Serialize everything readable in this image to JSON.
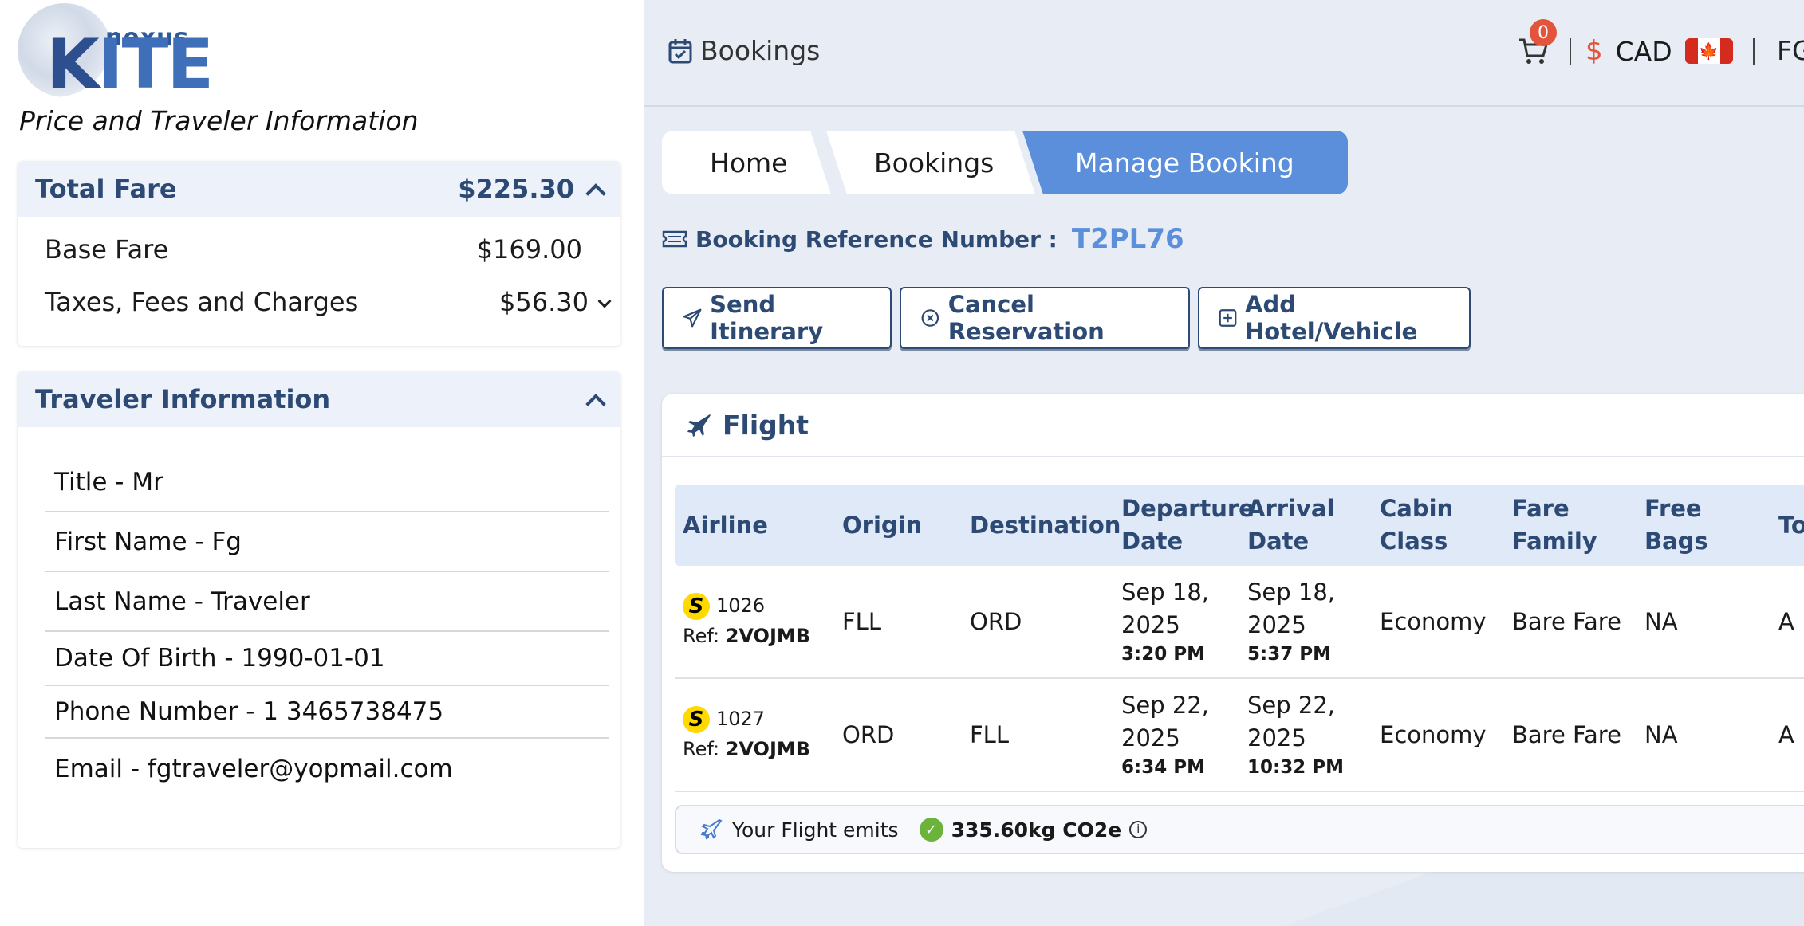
{
  "logo": {
    "small": "nexus",
    "big_k": "K",
    "big_rest": "ITE"
  },
  "left": {
    "heading": "Price and Traveler Information",
    "fare": {
      "title": "Total Fare",
      "total": "$225.30",
      "base_label": "Base Fare",
      "base_value": "$169.00",
      "taxes_label": "Taxes, Fees and Charges",
      "taxes_value": "$56.30"
    },
    "traveler": {
      "title": "Traveler Information",
      "items": [
        "Title - Mr",
        "First Name - Fg",
        "Last Name - Traveler",
        "Date Of Birth - 1990-01-01",
        "Phone Number - 1 3465738475",
        "Email - fgtraveler@yopmail.com"
      ]
    }
  },
  "topbar": {
    "bookings": "Bookings",
    "cart_count": "0",
    "currency_symbol": "$",
    "currency": "CAD",
    "flag_leaf": "🍁",
    "user": "FG"
  },
  "breadcrumb": {
    "home": "Home",
    "bookings": "Bookings",
    "current": "Manage Booking"
  },
  "booking_ref": {
    "label": "Booking Reference Number :",
    "value": "T2PL76"
  },
  "actions": {
    "send": "Send Itinerary",
    "cancel": "Cancel Reservation",
    "add": "Add Hotel/Vehicle"
  },
  "flight": {
    "title": "Flight",
    "headers": [
      "Airline",
      "Origin",
      "Destination",
      "Departure Date",
      "Arrival Date",
      "Cabin Class",
      "Fare Family",
      "Free Bags",
      "To"
    ],
    "rows": [
      {
        "flight_no": "1026",
        "ref_label": "Ref:",
        "ref": "2VOJMB",
        "origin": "FLL",
        "destination": "ORD",
        "dep_date": "Sep 18, 2025",
        "dep_time": "3:20 PM",
        "arr_date": "Sep 18, 2025",
        "arr_time": "5:37 PM",
        "cabin": "Economy",
        "fare_family": "Bare Fare",
        "bags": "NA",
        "extra": "A"
      },
      {
        "flight_no": "1027",
        "ref_label": "Ref:",
        "ref": "2VOJMB",
        "origin": "ORD",
        "destination": "FLL",
        "dep_date": "Sep 22, 2025",
        "dep_time": "6:34 PM",
        "arr_date": "Sep 22, 2025",
        "arr_time": "10:32 PM",
        "cabin": "Economy",
        "fare_family": "Bare Fare",
        "bags": "NA",
        "extra": "A"
      }
    ],
    "airline_logo_letter": "S",
    "emits_label": "Your Flight emits",
    "emits_value": "335.60kg CO2e"
  },
  "colors": {
    "accent": "#5b8fdc",
    "navy": "#2d4a74",
    "badge": "#e2543b",
    "panel_bg": "#e8edf5"
  }
}
